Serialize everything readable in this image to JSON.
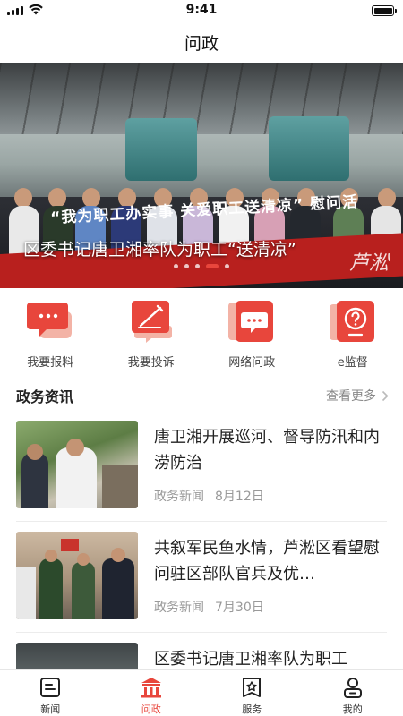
{
  "status_bar": {
    "time": "9:41"
  },
  "nav": {
    "title": "问政"
  },
  "banner": {
    "caption": "区委书记唐卫湘率队为职工“送清凉”",
    "slogan": "“我为职工办实事 关爱职工送清凉” 慰问活",
    "watermark": "芦淞",
    "slide_count": 5,
    "active_slide": 4
  },
  "quick_actions": [
    {
      "label": "我要报料",
      "icon": "chat-bubble-icon"
    },
    {
      "label": "我要投诉",
      "icon": "complaint-pen-icon"
    },
    {
      "label": "网络问政",
      "icon": "message-icon"
    },
    {
      "label": "e监督",
      "icon": "question-icon"
    }
  ],
  "section": {
    "title": "政务资讯",
    "more_label": "查看更多"
  },
  "news": [
    {
      "title": "唐卫湘开展巡河、督导防汛和内涝防治",
      "category": "政务新闻",
      "date": "8月12日"
    },
    {
      "title": "共叙军民鱼水情，芦淞区看望慰问驻区部队官兵及优…",
      "category": "政务新闻",
      "date": "7月30日"
    },
    {
      "title": "区委书记唐卫湘率队为职工",
      "category": "",
      "date": ""
    }
  ],
  "tabs": [
    {
      "label": "新闻",
      "icon": "news-icon",
      "active": false
    },
    {
      "label": "问政",
      "icon": "government-icon",
      "active": true
    },
    {
      "label": "服务",
      "icon": "service-icon",
      "active": false
    },
    {
      "label": "我的",
      "icon": "profile-icon",
      "active": false
    }
  ],
  "colors": {
    "accent": "#e8463c",
    "accent_light": "#f3b3a6"
  }
}
